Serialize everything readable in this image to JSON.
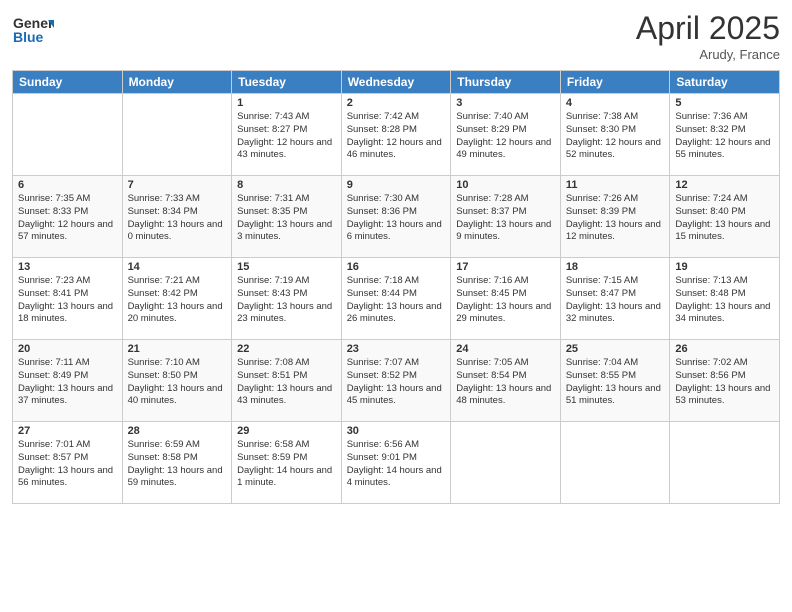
{
  "header": {
    "logo_general": "General",
    "logo_blue": "Blue",
    "month_title": "April 2025",
    "location": "Arudy, France"
  },
  "days_of_week": [
    "Sunday",
    "Monday",
    "Tuesday",
    "Wednesday",
    "Thursday",
    "Friday",
    "Saturday"
  ],
  "weeks": [
    [
      {
        "day": "",
        "sunrise": "",
        "sunset": "",
        "daylight": ""
      },
      {
        "day": "",
        "sunrise": "",
        "sunset": "",
        "daylight": ""
      },
      {
        "day": "1",
        "sunrise": "Sunrise: 7:43 AM",
        "sunset": "Sunset: 8:27 PM",
        "daylight": "Daylight: 12 hours and 43 minutes."
      },
      {
        "day": "2",
        "sunrise": "Sunrise: 7:42 AM",
        "sunset": "Sunset: 8:28 PM",
        "daylight": "Daylight: 12 hours and 46 minutes."
      },
      {
        "day": "3",
        "sunrise": "Sunrise: 7:40 AM",
        "sunset": "Sunset: 8:29 PM",
        "daylight": "Daylight: 12 hours and 49 minutes."
      },
      {
        "day": "4",
        "sunrise": "Sunrise: 7:38 AM",
        "sunset": "Sunset: 8:30 PM",
        "daylight": "Daylight: 12 hours and 52 minutes."
      },
      {
        "day": "5",
        "sunrise": "Sunrise: 7:36 AM",
        "sunset": "Sunset: 8:32 PM",
        "daylight": "Daylight: 12 hours and 55 minutes."
      }
    ],
    [
      {
        "day": "6",
        "sunrise": "Sunrise: 7:35 AM",
        "sunset": "Sunset: 8:33 PM",
        "daylight": "Daylight: 12 hours and 57 minutes."
      },
      {
        "day": "7",
        "sunrise": "Sunrise: 7:33 AM",
        "sunset": "Sunset: 8:34 PM",
        "daylight": "Daylight: 13 hours and 0 minutes."
      },
      {
        "day": "8",
        "sunrise": "Sunrise: 7:31 AM",
        "sunset": "Sunset: 8:35 PM",
        "daylight": "Daylight: 13 hours and 3 minutes."
      },
      {
        "day": "9",
        "sunrise": "Sunrise: 7:30 AM",
        "sunset": "Sunset: 8:36 PM",
        "daylight": "Daylight: 13 hours and 6 minutes."
      },
      {
        "day": "10",
        "sunrise": "Sunrise: 7:28 AM",
        "sunset": "Sunset: 8:37 PM",
        "daylight": "Daylight: 13 hours and 9 minutes."
      },
      {
        "day": "11",
        "sunrise": "Sunrise: 7:26 AM",
        "sunset": "Sunset: 8:39 PM",
        "daylight": "Daylight: 13 hours and 12 minutes."
      },
      {
        "day": "12",
        "sunrise": "Sunrise: 7:24 AM",
        "sunset": "Sunset: 8:40 PM",
        "daylight": "Daylight: 13 hours and 15 minutes."
      }
    ],
    [
      {
        "day": "13",
        "sunrise": "Sunrise: 7:23 AM",
        "sunset": "Sunset: 8:41 PM",
        "daylight": "Daylight: 13 hours and 18 minutes."
      },
      {
        "day": "14",
        "sunrise": "Sunrise: 7:21 AM",
        "sunset": "Sunset: 8:42 PM",
        "daylight": "Daylight: 13 hours and 20 minutes."
      },
      {
        "day": "15",
        "sunrise": "Sunrise: 7:19 AM",
        "sunset": "Sunset: 8:43 PM",
        "daylight": "Daylight: 13 hours and 23 minutes."
      },
      {
        "day": "16",
        "sunrise": "Sunrise: 7:18 AM",
        "sunset": "Sunset: 8:44 PM",
        "daylight": "Daylight: 13 hours and 26 minutes."
      },
      {
        "day": "17",
        "sunrise": "Sunrise: 7:16 AM",
        "sunset": "Sunset: 8:45 PM",
        "daylight": "Daylight: 13 hours and 29 minutes."
      },
      {
        "day": "18",
        "sunrise": "Sunrise: 7:15 AM",
        "sunset": "Sunset: 8:47 PM",
        "daylight": "Daylight: 13 hours and 32 minutes."
      },
      {
        "day": "19",
        "sunrise": "Sunrise: 7:13 AM",
        "sunset": "Sunset: 8:48 PM",
        "daylight": "Daylight: 13 hours and 34 minutes."
      }
    ],
    [
      {
        "day": "20",
        "sunrise": "Sunrise: 7:11 AM",
        "sunset": "Sunset: 8:49 PM",
        "daylight": "Daylight: 13 hours and 37 minutes."
      },
      {
        "day": "21",
        "sunrise": "Sunrise: 7:10 AM",
        "sunset": "Sunset: 8:50 PM",
        "daylight": "Daylight: 13 hours and 40 minutes."
      },
      {
        "day": "22",
        "sunrise": "Sunrise: 7:08 AM",
        "sunset": "Sunset: 8:51 PM",
        "daylight": "Daylight: 13 hours and 43 minutes."
      },
      {
        "day": "23",
        "sunrise": "Sunrise: 7:07 AM",
        "sunset": "Sunset: 8:52 PM",
        "daylight": "Daylight: 13 hours and 45 minutes."
      },
      {
        "day": "24",
        "sunrise": "Sunrise: 7:05 AM",
        "sunset": "Sunset: 8:54 PM",
        "daylight": "Daylight: 13 hours and 48 minutes."
      },
      {
        "day": "25",
        "sunrise": "Sunrise: 7:04 AM",
        "sunset": "Sunset: 8:55 PM",
        "daylight": "Daylight: 13 hours and 51 minutes."
      },
      {
        "day": "26",
        "sunrise": "Sunrise: 7:02 AM",
        "sunset": "Sunset: 8:56 PM",
        "daylight": "Daylight: 13 hours and 53 minutes."
      }
    ],
    [
      {
        "day": "27",
        "sunrise": "Sunrise: 7:01 AM",
        "sunset": "Sunset: 8:57 PM",
        "daylight": "Daylight: 13 hours and 56 minutes."
      },
      {
        "day": "28",
        "sunrise": "Sunrise: 6:59 AM",
        "sunset": "Sunset: 8:58 PM",
        "daylight": "Daylight: 13 hours and 59 minutes."
      },
      {
        "day": "29",
        "sunrise": "Sunrise: 6:58 AM",
        "sunset": "Sunset: 8:59 PM",
        "daylight": "Daylight: 14 hours and 1 minute."
      },
      {
        "day": "30",
        "sunrise": "Sunrise: 6:56 AM",
        "sunset": "Sunset: 9:01 PM",
        "daylight": "Daylight: 14 hours and 4 minutes."
      },
      {
        "day": "",
        "sunrise": "",
        "sunset": "",
        "daylight": ""
      },
      {
        "day": "",
        "sunrise": "",
        "sunset": "",
        "daylight": ""
      },
      {
        "day": "",
        "sunrise": "",
        "sunset": "",
        "daylight": ""
      }
    ]
  ]
}
